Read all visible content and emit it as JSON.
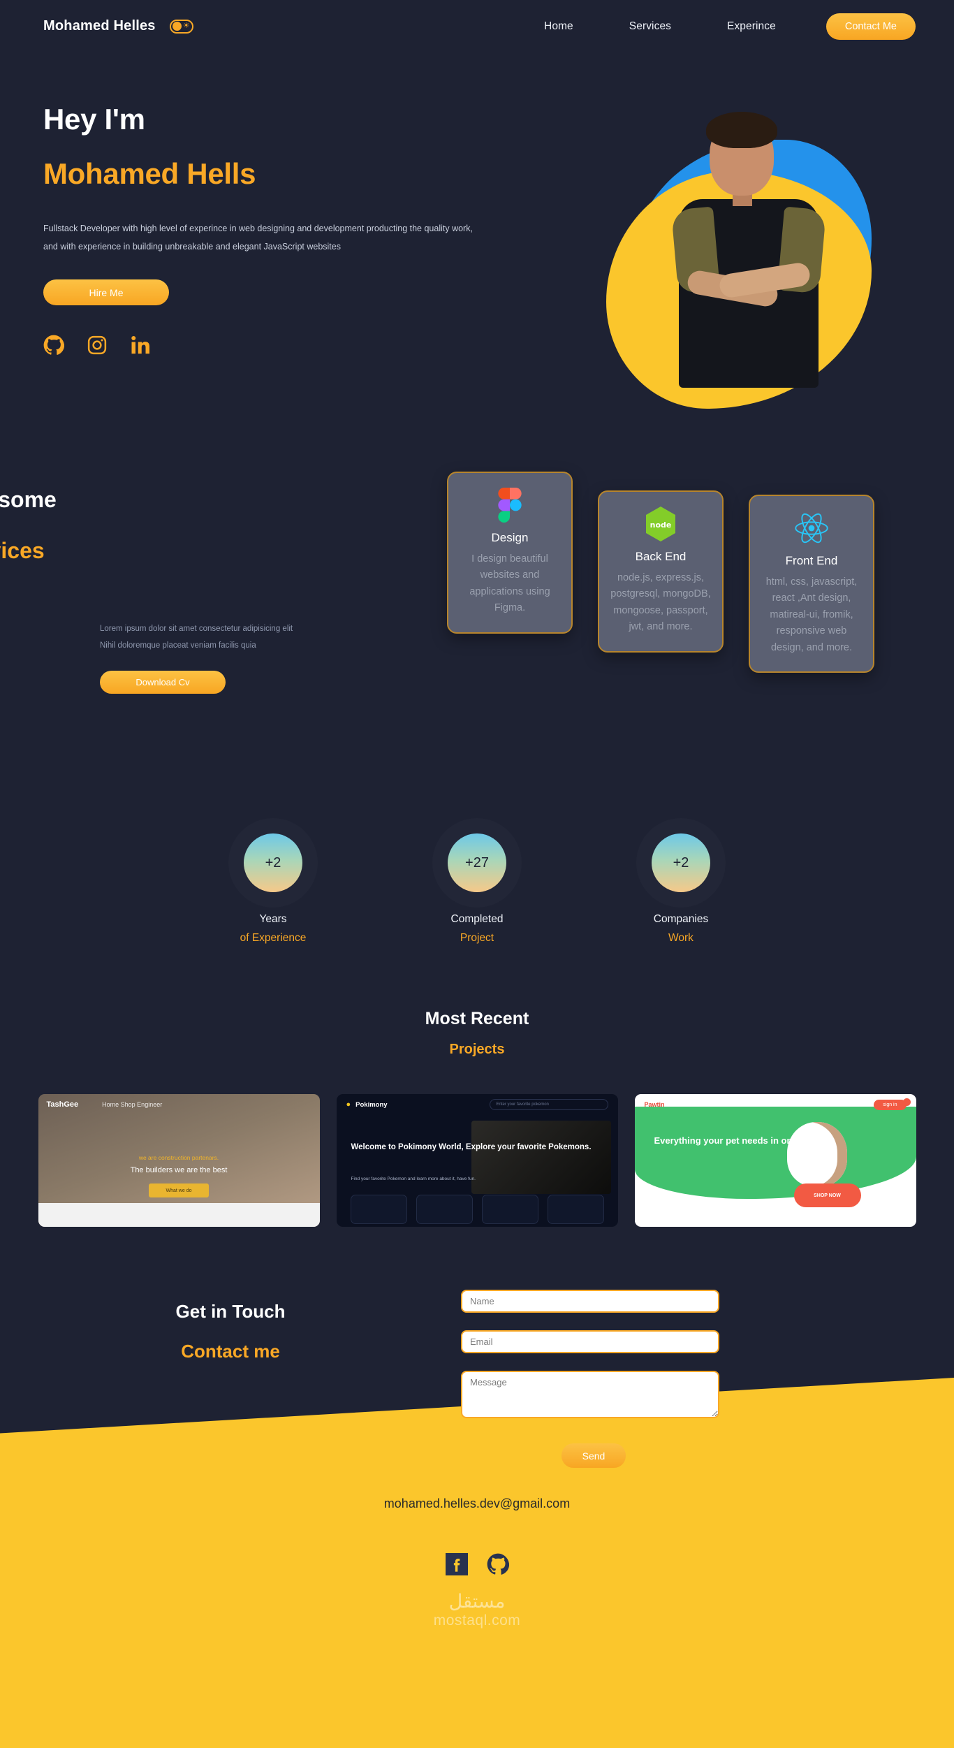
{
  "nav": {
    "brand": "Mohamed Helles",
    "theme_toggle_icon": "sun-moon-toggle-icon",
    "links": [
      "Home",
      "Services",
      "Experince"
    ],
    "contact_label": "Contact Me"
  },
  "hero": {
    "greeting": "Hey I'm",
    "name": "Mohamed Hells",
    "description": "Fullstack Developer with high level of experince in web designing and development producting the quality work, and with experience in building unbreakable and elegant JavaScript websites",
    "cta_label": "Hire Me",
    "socials": [
      "github-icon",
      "instagram-icon",
      "linkedin-icon"
    ]
  },
  "services": {
    "title_line1": "Awesome",
    "title_line2": "Services",
    "subtitle_line1": "Lorem ipsum dolor sit amet consectetur adipisicing elit",
    "subtitle_line2": "Nihil doloremque placeat veniam facilis quia",
    "cv_label": "Download Cv",
    "cards": [
      {
        "icon": "figma-icon",
        "title": "Design",
        "text": "I design beautiful websites and applications using Figma."
      },
      {
        "icon": "nodejs-icon",
        "title": "Back End",
        "text": "node.js, express.js, postgresql, mongoDB, mongoose, passport, jwt, and more."
      },
      {
        "icon": "react-icon",
        "title": "Front End",
        "text": "html, css, javascript, react ,Ant design, matireal-ui, fromik, responsive web design, and more."
      }
    ]
  },
  "stats": [
    {
      "value": "+2",
      "label1": "Years",
      "label2": "of Experience"
    },
    {
      "value": "+27",
      "label1": "Completed",
      "label2": "Project"
    },
    {
      "value": "+2",
      "label1": "Companies",
      "label2": "Work"
    }
  ],
  "projects": {
    "title_line1": "Most Recent",
    "title_line2": "Projects",
    "items": [
      {
        "name": "TashGee",
        "logo": "TashGee",
        "nav": "Home   Shop   Engineer",
        "tagline": "we are construction partenars.",
        "heading": "The builders we are the best",
        "cta": "What we do"
      },
      {
        "name": "Pokimony",
        "logo": "Pokimony",
        "search_placeholder": "Enter your favorite pokemon",
        "heading": "Welcome to Pokimony World, Explore your favorite Pokemons.",
        "sub": "Find your favorite Pokemon and learn more about it, have fun."
      },
      {
        "name": "Pawtin",
        "logo": "Pawtin",
        "signin": "sign in",
        "heading": "Everything your pet needs in one place",
        "cta": "SHOP NOW"
      }
    ]
  },
  "contact": {
    "title_line1": "Get in Touch",
    "title_line2": "Contact me",
    "name_placeholder": "Name",
    "email_placeholder": "Email",
    "message_placeholder": "Message",
    "send_label": "Send"
  },
  "footer": {
    "email": "mohamed.helles.dev@gmail.com",
    "icons": [
      "facebook-icon",
      "github-icon"
    ],
    "watermark_ar": "مستقل",
    "watermark_en": "mostaql.com"
  },
  "colors": {
    "background": "#1e2233",
    "accent": "#f9a826",
    "footer": "#fbc62c",
    "card": "#5b6072",
    "card_border": "#b7852c"
  }
}
